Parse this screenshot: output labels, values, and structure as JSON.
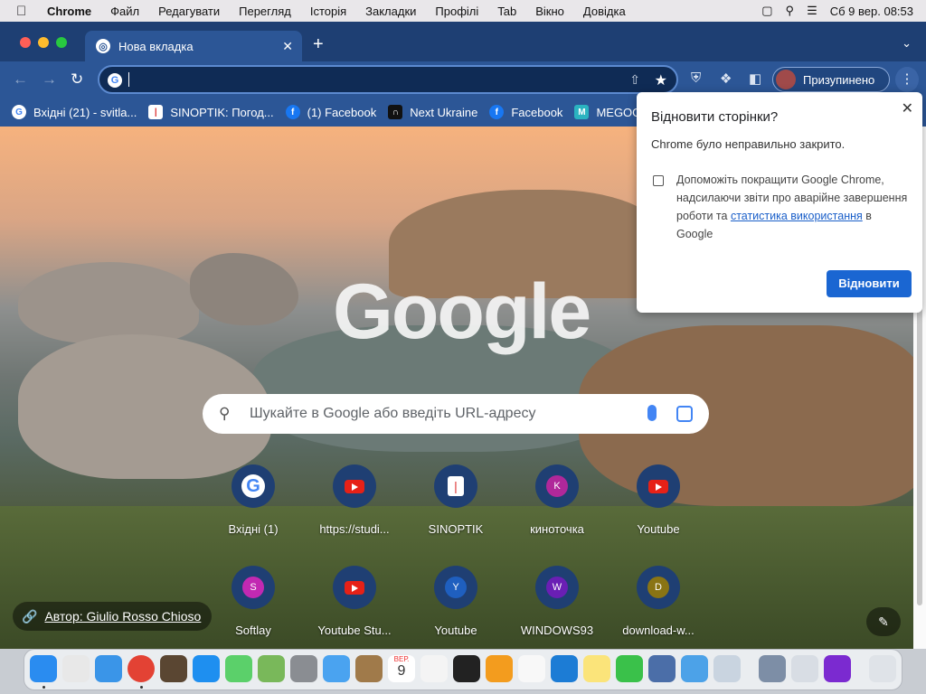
{
  "menubar": {
    "app": "Chrome",
    "items": [
      "Файл",
      "Редагувати",
      "Перегляд",
      "Історія",
      "Закладки",
      "Профілі",
      "Tab",
      "Вікно",
      "Довідка"
    ],
    "datetime": "Сб 9 вер.  08:53"
  },
  "tab": {
    "title": "Нова вкладка",
    "close": "✕"
  },
  "toolbar": {
    "omnibox_value": "",
    "profile_label": "Призупинено"
  },
  "bookmarks": [
    {
      "label": "Вхідні (21) - svitla...",
      "icon": "google-icon",
      "color": "#ffffff"
    },
    {
      "label": "SINOPTIK: Погод...",
      "icon": "thermometer-icon",
      "color": "#ffffff"
    },
    {
      "label": "(1) Facebook",
      "icon": "facebook-icon",
      "color": "#1877f2"
    },
    {
      "label": "Next Ukraine",
      "icon": "next-ukraine-icon",
      "color": "#111111"
    },
    {
      "label": "Facebook",
      "icon": "facebook-icon",
      "color": "#1877f2"
    },
    {
      "label": "MEGOG",
      "icon": "megogo-icon",
      "color": "#2bb3c0"
    }
  ],
  "search": {
    "placeholder": "Шукайте в Google або введіть URL-адресу"
  },
  "shortcuts": [
    {
      "label": "Вхідні (1)",
      "icon": "google-icon"
    },
    {
      "label": "https://studi...",
      "icon": "youtube-icon"
    },
    {
      "label": "SINOPTIK",
      "icon": "thermometer-icon"
    },
    {
      "label": "киноточка",
      "icon": "letter-k-icon",
      "letter": "K",
      "color": "#b0289a"
    },
    {
      "label": "Youtube",
      "icon": "youtube-icon"
    },
    {
      "label": "Softlay",
      "icon": "letter-s-icon",
      "letter": "S",
      "color": "#c229b2"
    },
    {
      "label": "Youtube Stu...",
      "icon": "youtube-icon"
    },
    {
      "label": "Youtube",
      "icon": "letter-y-icon",
      "letter": "Y",
      "color": "#1f5fbf"
    },
    {
      "label": "WINDOWS93",
      "icon": "letter-w-icon",
      "letter": "W",
      "color": "#6a1fb4"
    },
    {
      "label": "download-w...",
      "icon": "letter-d-icon",
      "letter": "D",
      "color": "#8a7414"
    }
  ],
  "author": {
    "label": "Автор: Giulio Rosso Chioso"
  },
  "popup": {
    "title": "Відновити сторінки?",
    "message": "Chrome було неправильно закрито.",
    "checkbox_text_before": "Допоможіть покращити Google Chrome, надсилаючи звіти про аварійне завершення роботи та ",
    "checkbox_link": "статистика використання",
    "checkbox_text_after": " в Google",
    "restore_button": "Відновити"
  },
  "dock": {
    "calendar_month": "ВЕР.",
    "calendar_day": "9"
  },
  "colors": {
    "tabstrip": "#1e3f73",
    "toolbar": "#2c5696",
    "accent": "#1a66d2"
  }
}
